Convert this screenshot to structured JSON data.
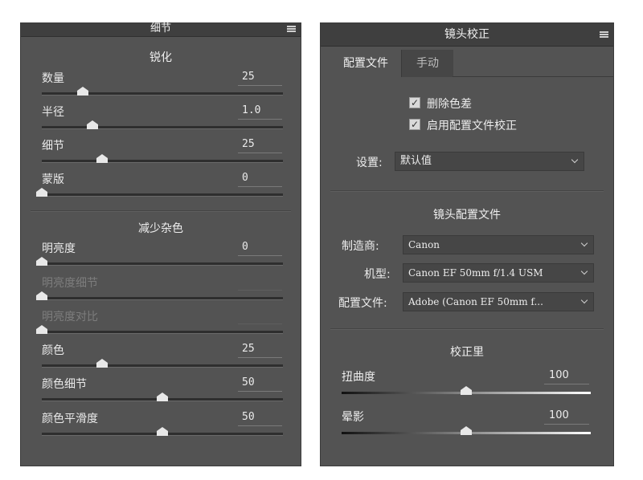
{
  "left_panel": {
    "title": "细节",
    "sharpening": {
      "title": "锐化",
      "sliders": [
        {
          "label": "数量",
          "value": "25",
          "fraction": 0.17
        },
        {
          "label": "半径",
          "value": "1.0",
          "fraction": 0.21
        },
        {
          "label": "细节",
          "value": "25",
          "fraction": 0.25
        },
        {
          "label": "蒙版",
          "value": "0",
          "fraction": 0.0
        }
      ]
    },
    "noise_reduction": {
      "title": "减少杂色",
      "sliders": [
        {
          "label": "明亮度",
          "value": "0",
          "fraction": 0.0
        },
        {
          "label": "明亮度细节",
          "value": "",
          "fraction": 0.0
        },
        {
          "label": "明亮度对比",
          "value": "",
          "fraction": 0.0
        },
        {
          "label": "颜色",
          "value": "25",
          "fraction": 0.25
        },
        {
          "label": "颜色细节",
          "value": "50",
          "fraction": 0.5
        },
        {
          "label": "颜色平滑度",
          "value": "50",
          "fraction": 0.5
        }
      ]
    }
  },
  "right_panel": {
    "title": "镜头校正",
    "tabs": {
      "profile": "配置文件",
      "manual": "手动"
    },
    "checkboxes": {
      "remove_ca": {
        "label": "删除色差",
        "checked": "✓"
      },
      "enable_profile": {
        "label": "启用配置文件校正",
        "checked": "✓"
      }
    },
    "setup": {
      "label": "设置:",
      "value": "默认值"
    },
    "lens_profile": {
      "title": "镜头配置文件",
      "make": {
        "label": "制造商:",
        "value": "Canon"
      },
      "model": {
        "label": "机型:",
        "value": "Canon EF 50mm f/1.4 USM"
      },
      "profile": {
        "label": "配置文件:",
        "value": "Adobe (Canon EF 50mm f..."
      }
    },
    "correction": {
      "title": "校正里",
      "distortion": {
        "label": "扭曲度",
        "value": "100",
        "fraction": 0.5
      },
      "vignetting": {
        "label": "晕影",
        "value": "100",
        "fraction": 0.5
      }
    }
  }
}
